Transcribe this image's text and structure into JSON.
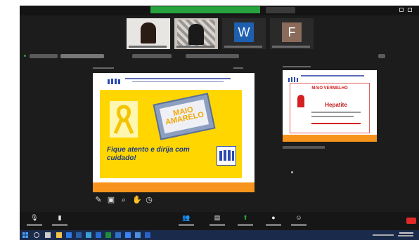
{
  "app": {
    "colors": {
      "accent_green": "#27a33d",
      "leave_red": "#e02828",
      "slide_yellow": "#ffd600",
      "slide_orange": "#f7941d"
    }
  },
  "participants": [
    {
      "avatar_letter": "",
      "kind": "video"
    },
    {
      "avatar_letter": "",
      "kind": "video"
    },
    {
      "avatar_letter": "W",
      "kind": "letter",
      "color": "#1f5fb0"
    },
    {
      "avatar_letter": "F",
      "kind": "letter",
      "color": "#8a6a5a"
    }
  ],
  "main_slide": {
    "tag_text": "MAIO AMARELO",
    "message": "Fique atento e dirija com cuidado!"
  },
  "side_slide": {
    "title": "MAIO VERMELHO",
    "keyword": "Hepatite"
  },
  "drawing_tools": [
    {
      "icon": "pen-icon",
      "glyph": "✎"
    },
    {
      "icon": "image-icon",
      "glyph": "▣"
    },
    {
      "icon": "zoom-icon",
      "glyph": "⌕"
    },
    {
      "icon": "hand-icon",
      "glyph": "✋"
    },
    {
      "icon": "clock-icon",
      "glyph": "◷"
    }
  ],
  "controls": [
    {
      "icon": "microphone-icon",
      "glyph": "🎙"
    },
    {
      "icon": "camera-icon",
      "glyph": "▮"
    },
    {
      "icon": "participants-icon",
      "glyph": "👥"
    },
    {
      "icon": "chat-icon",
      "glyph": "▤"
    },
    {
      "icon": "share-screen-icon",
      "glyph": "⬆"
    },
    {
      "icon": "record-icon",
      "glyph": "●"
    },
    {
      "icon": "reactions-icon",
      "glyph": "☺"
    }
  ]
}
